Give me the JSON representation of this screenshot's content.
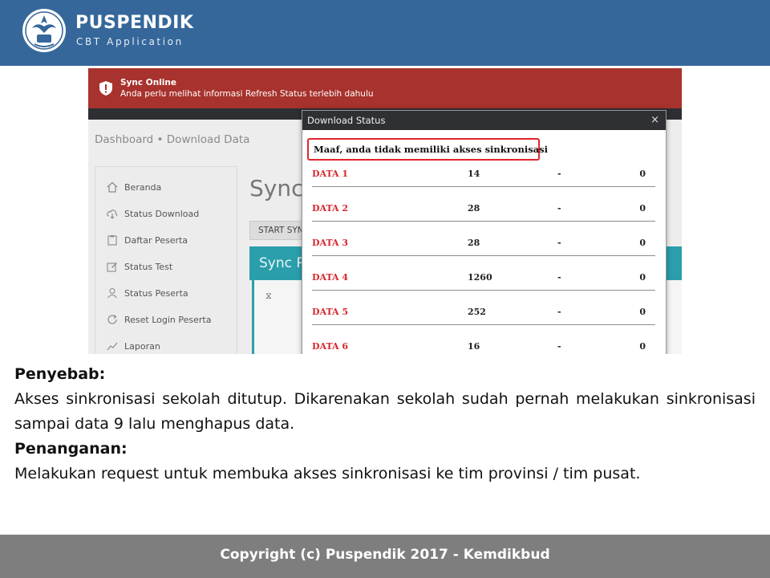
{
  "header": {
    "brand_title": "PUSPENDIK",
    "brand_subtitle": "CBT Application",
    "logo_icon": "kemdikbud-logo-icon"
  },
  "screenshot": {
    "alert": {
      "title": "Sync Online",
      "message": "Anda perlu melihat informasi Refresh Status terlebih dahulu",
      "color": "#a8322d"
    },
    "breadcrumb": "Dashboard • Download Data",
    "sidebar": {
      "items": [
        {
          "label": "Beranda",
          "icon": "home-icon"
        },
        {
          "label": "Status Download",
          "icon": "cloud-download-icon"
        },
        {
          "label": "Daftar Peserta",
          "icon": "clipboard-icon"
        },
        {
          "label": "Status Test",
          "icon": "edit-icon"
        },
        {
          "label": "Status Peserta",
          "icon": "user-icon"
        },
        {
          "label": "Reset Login Peserta",
          "icon": "refresh-icon"
        },
        {
          "label": "Laporan",
          "icon": "chart-line-icon"
        }
      ]
    },
    "main": {
      "title": "Sync",
      "start_button": "START SYNC",
      "panel_title": "Sync P",
      "panel_glyph": "⧖",
      "accent": "#2a9fab"
    },
    "modal": {
      "title": "Download Status",
      "close": "×",
      "warning": "Maaf, anda tidak memiliki akses sinkronisasi",
      "rows": [
        {
          "name": "DATA 1",
          "count": "14",
          "sep": "-",
          "done": "0"
        },
        {
          "name": "DATA 2",
          "count": "28",
          "sep": "-",
          "done": "0"
        },
        {
          "name": "DATA 3",
          "count": "28",
          "sep": "-",
          "done": "0"
        },
        {
          "name": "DATA 4",
          "count": "1260",
          "sep": "-",
          "done": "0"
        },
        {
          "name": "DATA 5",
          "count": "252",
          "sep": "-",
          "done": "0"
        },
        {
          "name": "DATA 6",
          "count": "16",
          "sep": "-",
          "done": "0"
        }
      ]
    }
  },
  "explanation": {
    "cause_heading": "Penyebab:",
    "cause_text": "Akses sinkronisasi sekolah ditutup. Dikarenakan sekolah sudah pernah melakukan sinkronisasi sampai data 9 lalu menghapus data.",
    "fix_heading": "Penanganan:",
    "fix_text": "Melakukan request untuk membuka akses sinkronisasi ke tim provinsi / tim pusat."
  },
  "footer": {
    "text": "Copyright (c) Puspendik 2017 - Kemdikbud"
  }
}
